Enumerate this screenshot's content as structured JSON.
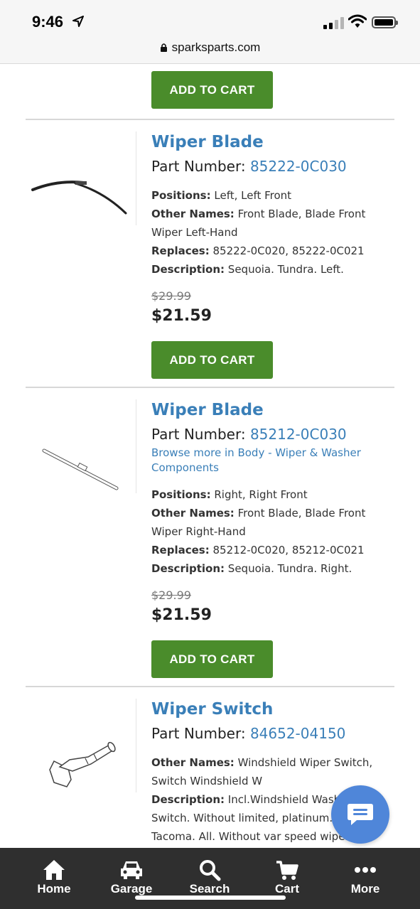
{
  "status": {
    "time": "9:46",
    "url": "sparksparts.com"
  },
  "top_button": {
    "label": "ADD TO CART"
  },
  "products": [
    {
      "title": "Wiper Blade",
      "part_label": "Part Number:",
      "part_number": "85222-0C030",
      "specs": [
        {
          "label": "Positions:",
          "value": "Left, Left Front"
        },
        {
          "label": "Other Names:",
          "value": "Front Blade, Blade Front Wiper Left-Hand"
        },
        {
          "label": "Replaces:",
          "value": "85222-0C020, 85222-0C021"
        },
        {
          "label": "Description:",
          "value": "Sequoia. Tundra. Left."
        }
      ],
      "old_price": "$29.99",
      "price": "$21.59",
      "button": "ADD TO CART"
    },
    {
      "title": "Wiper Blade",
      "part_label": "Part Number:",
      "part_number": "85212-0C030",
      "browse": "Browse more in Body - Wiper & Washer Components",
      "specs": [
        {
          "label": "Positions:",
          "value": "Right, Right Front"
        },
        {
          "label": "Other Names:",
          "value": "Front Blade, Blade Front Wiper Right-Hand"
        },
        {
          "label": "Replaces:",
          "value": "85212-0C020, 85212-0C021"
        },
        {
          "label": "Description:",
          "value": "Sequoia. Tundra. Right."
        }
      ],
      "old_price": "$29.99",
      "price": "$21.59",
      "button": "ADD TO CART"
    },
    {
      "title": "Wiper Switch",
      "part_label": "Part Number:",
      "part_number": "84652-04150",
      "specs": [
        {
          "label": "Other Names:",
          "value": "Windshield Wiper Switch, Switch Windshield W"
        },
        {
          "label": "Description:",
          "value": "Incl.Windshield Washer Switch. Without limited, platinum. T Tacoma. All. Without var speed wiper."
        }
      ]
    }
  ],
  "bottom_nav": [
    {
      "label": "Home",
      "icon": "home-icon"
    },
    {
      "label": "Garage",
      "icon": "car-icon"
    },
    {
      "label": "Search",
      "icon": "search-icon"
    },
    {
      "label": "Cart",
      "icon": "cart-icon"
    },
    {
      "label": "More",
      "icon": "more-dots-icon"
    }
  ],
  "colors": {
    "accent_blue": "#3a7fb8",
    "button_green": "#4a8c2b",
    "nav_bg": "#2f2f2f",
    "chat_blue": "#4f86d9"
  }
}
